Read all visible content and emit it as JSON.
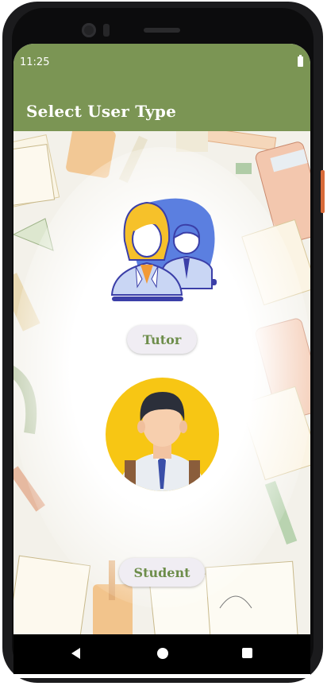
{
  "status_bar": {
    "time": "11:25"
  },
  "app_bar": {
    "title": "Select User Type"
  },
  "options": {
    "tutor_label": "Tutor",
    "student_label": "Student"
  },
  "icons": {
    "tutor": "tutor-avatar-icon",
    "student": "student-avatar-icon"
  },
  "colors": {
    "primary": "#7b9554",
    "button_text": "#6d8d4a",
    "button_bg": "#f0edf3"
  }
}
